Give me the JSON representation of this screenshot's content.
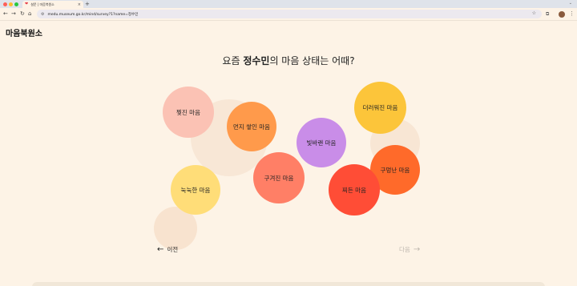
{
  "browser": {
    "tab_title": "설문 | 마음북원소",
    "tab_close": "×",
    "new_tab": "+",
    "url": "medu.museum.go.kr/mind/survey?1?name=정수민"
  },
  "page": {
    "logo": "마음북원소",
    "question_prefix": "요즘 ",
    "question_name": "정수민",
    "question_suffix": "의 마음 상태는 어때?"
  },
  "options": [
    {
      "label": "찢진 마음",
      "color": "#fbc2b4"
    },
    {
      "label": "먼지 쌓인 마음",
      "color": "#ff9a4b"
    },
    {
      "label": "빛바랜 마음",
      "color": "#c98de8"
    },
    {
      "label": "더러워진 마음",
      "color": "#fcc53a"
    },
    {
      "label": "구겨진 마음",
      "color": "#ff7f66"
    },
    {
      "label": "구멍난 마음",
      "color": "#ff6a2a"
    },
    {
      "label": "눅눅한 마음",
      "color": "#ffdd78"
    },
    {
      "label": "찌든 마음",
      "color": "#ff4d36"
    }
  ],
  "navigation": {
    "prev_label": "이전",
    "next_label": "다음"
  },
  "icons": {
    "back": "arrow-left-icon",
    "forward": "arrow-right-icon",
    "reload": "reload-icon",
    "home": "home-icon",
    "star": "star-icon",
    "extensions": "puzzle-icon",
    "menu": "menu-dots-icon"
  }
}
